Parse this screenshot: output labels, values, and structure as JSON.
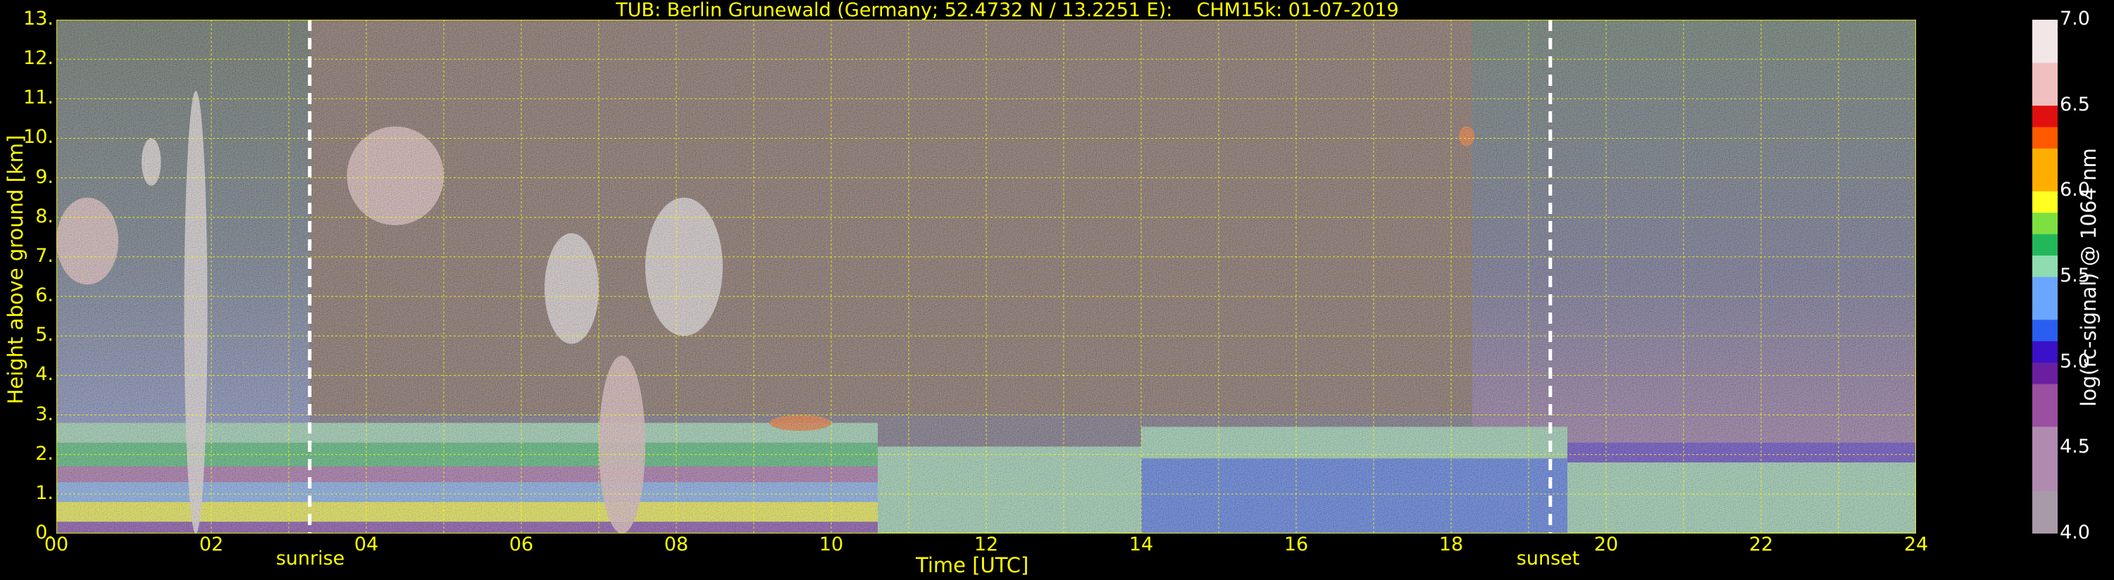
{
  "title": "TUB: Berlin Grunewald (Germany; 52.4732 N / 13.2251 E):    CHM15k: 01-07-2019",
  "chart_data": {
    "type": "heatmap",
    "title": "TUB: Berlin Grunewald (Germany; 52.4732 N / 13.2251 E):    CHM15k: 01-07-2019",
    "xlabel": "Time [UTC]",
    "ylabel": "Height above ground [km]",
    "xlim": [
      0,
      24
    ],
    "ylim": [
      0,
      13
    ],
    "x_ticks": [
      "00",
      "02",
      "04",
      "06",
      "08",
      "10",
      "12",
      "14",
      "16",
      "18",
      "20",
      "22",
      "24"
    ],
    "y_ticks": [
      "0.",
      "1.",
      "2.",
      "3.",
      "4.",
      "5.",
      "6.",
      "7.",
      "8.",
      "9.",
      "10.",
      "11.",
      "12.",
      "13."
    ],
    "grid": true,
    "colorbar": {
      "label": "log(rc-signal) @ 1064 nm",
      "range": [
        4.0,
        7.0
      ],
      "ticks": [
        "4.0",
        "4.5",
        "5.0",
        "5.5",
        "6.0",
        "6.5",
        "7.0"
      ]
    },
    "annotations": [
      {
        "label": "sunrise",
        "x": 3.27
      },
      {
        "label": "sunset",
        "x": 19.28
      }
    ],
    "layers": [
      {
        "t0": 0,
        "t1": 10.6,
        "h0": 0.0,
        "h1": 0.3,
        "value": 4.9
      },
      {
        "t0": 0,
        "t1": 10.6,
        "h0": 0.3,
        "h1": 0.8,
        "value": 5.9
      },
      {
        "t0": 0,
        "t1": 10.6,
        "h0": 0.8,
        "h1": 1.3,
        "value": 5.4
      },
      {
        "t0": 0,
        "t1": 10.6,
        "h0": 1.3,
        "h1": 1.7,
        "value": 4.8
      },
      {
        "t0": 0,
        "t1": 10.6,
        "h0": 1.7,
        "h1": 2.3,
        "value": 5.7
      },
      {
        "t0": 0,
        "t1": 10.6,
        "h0": 2.3,
        "h1": 2.8,
        "value": 5.5
      },
      {
        "t0": 10.6,
        "t1": 14.0,
        "h0": 0.0,
        "h1": 2.2,
        "value": 5.5
      },
      {
        "t0": 14.0,
        "t1": 19.5,
        "h0": 0.0,
        "h1": 1.9,
        "value": 5.15
      },
      {
        "t0": 14.0,
        "t1": 19.5,
        "h0": 1.9,
        "h1": 2.7,
        "value": 5.5
      },
      {
        "t0": 19.5,
        "t1": 24.0,
        "h0": 0.0,
        "h1": 1.8,
        "value": 5.5
      },
      {
        "t0": 19.5,
        "t1": 24.0,
        "h0": 1.8,
        "h1": 2.3,
        "value": 5.1
      }
    ],
    "clouds": [
      {
        "t0": 1.1,
        "t1": 1.35,
        "h0": 8.8,
        "h1": 10.0,
        "value": 6.9
      },
      {
        "t0": 1.65,
        "t1": 1.95,
        "h0": 0.0,
        "h1": 11.2,
        "value": 6.9
      },
      {
        "t0": 0.0,
        "t1": 0.8,
        "h0": 6.3,
        "h1": 8.5,
        "value": 6.6
      },
      {
        "t0": 3.75,
        "t1": 5.0,
        "h0": 7.8,
        "h1": 10.3,
        "value": 6.7
      },
      {
        "t0": 6.3,
        "t1": 7.0,
        "h0": 4.8,
        "h1": 7.6,
        "value": 6.8
      },
      {
        "t0": 7.0,
        "t1": 7.6,
        "h0": 0.0,
        "h1": 4.5,
        "value": 6.5
      },
      {
        "t0": 7.6,
        "t1": 8.6,
        "h0": 5.0,
        "h1": 8.5,
        "value": 6.8
      },
      {
        "t0": 9.2,
        "t1": 10.0,
        "h0": 2.6,
        "h1": 3.0,
        "value": 6.2
      },
      {
        "t0": 18.1,
        "t1": 18.3,
        "h0": 9.8,
        "h1": 10.3,
        "value": 6.3
      }
    ]
  }
}
